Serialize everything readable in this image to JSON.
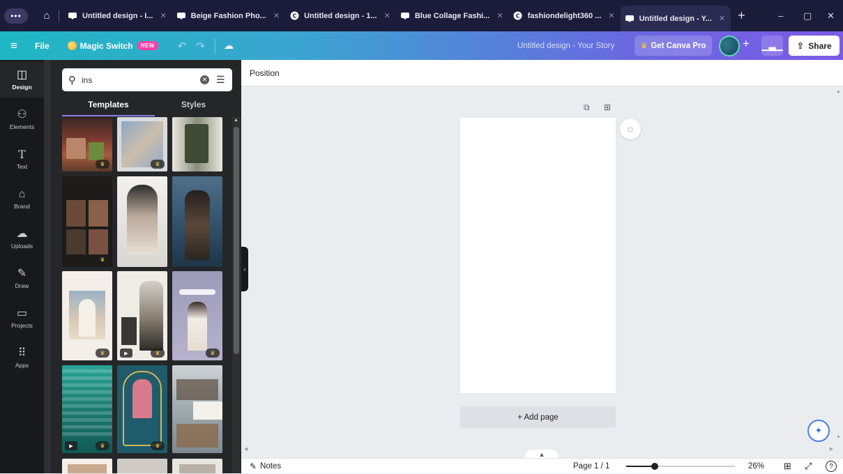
{
  "browser": {
    "tabs": [
      {
        "title": "Untitled design - I...",
        "favicon": "canva-design-icon",
        "active": false
      },
      {
        "title": "Beige Fashion Pho...",
        "favicon": "canva-design-icon",
        "active": false
      },
      {
        "title": "Untitled design - 1...",
        "favicon": "canva-c-icon",
        "active": false
      },
      {
        "title": "Blue Collage Fashi...",
        "favicon": "canva-design-icon",
        "active": false
      },
      {
        "title": "fashiondelight360 ...",
        "favicon": "canva-c-icon",
        "active": false
      },
      {
        "title": "Untitled design - Y...",
        "favicon": "canva-design-icon",
        "active": true
      }
    ],
    "new_tab": "+",
    "window_controls": {
      "minimize": "–",
      "maximize": "▢",
      "close": "✕"
    }
  },
  "toolbar": {
    "file_label": "File",
    "magic_switch_label": "Magic Switch",
    "new_badge": "NEW",
    "doc_title": "Untitled design - Your Story",
    "pro_label": "Get Canva Pro",
    "share_label": "Share"
  },
  "rail": {
    "items": [
      {
        "label": "Design",
        "icon": "design-icon",
        "active": true
      },
      {
        "label": "Elements",
        "icon": "elements-icon",
        "active": false
      },
      {
        "label": "Text",
        "icon": "text-icon",
        "active": false
      },
      {
        "label": "Brand",
        "icon": "brand-icon",
        "active": false
      },
      {
        "label": "Uploads",
        "icon": "uploads-icon",
        "active": false
      },
      {
        "label": "Draw",
        "icon": "draw-icon",
        "active": false
      },
      {
        "label": "Projects",
        "icon": "projects-icon",
        "active": false
      },
      {
        "label": "Apps",
        "icon": "apps-icon",
        "active": false
      }
    ]
  },
  "panel": {
    "search_value": "ins",
    "tabs": [
      "Templates",
      "Styles"
    ],
    "active_tab": "Templates"
  },
  "workspace": {
    "context_label": "Position",
    "add_page_label": "+ Add page"
  },
  "footer": {
    "notes_label": "Notes",
    "page_indicator": "Page 1 / 1",
    "zoom": "26%",
    "zoom_fraction": 0.26
  },
  "colors": {
    "toolbar_start": "#1fb7c3",
    "toolbar_end": "#7b5ae6",
    "panel_bg": "#252627",
    "rail_bg": "#18191b",
    "tab_bar": "#1b1b3a"
  }
}
